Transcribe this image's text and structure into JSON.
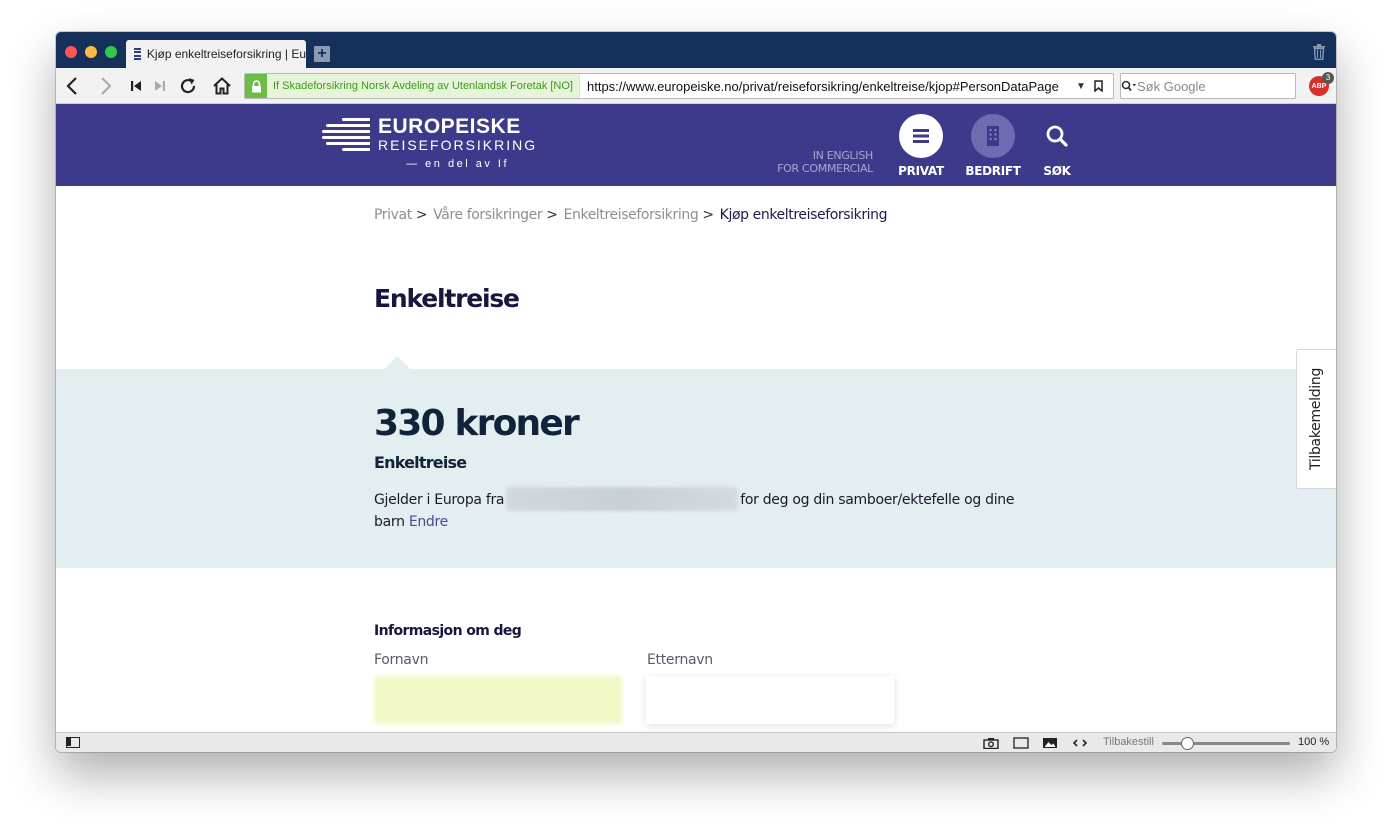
{
  "browser": {
    "tab_title": "Kjøp enkeltreiseforsikring | Eu",
    "new_tab_label": "+",
    "certificate": "If Skadeforsikring Norsk Avdeling av Utenlandsk Foretak [NO]",
    "url": "https://www.europeiske.no/privat/reiseforsikring/enkeltreise/kjop#PersonDataPage",
    "search_placeholder": "Søk Google",
    "adblock_label": "ABP",
    "adblock_count": "3"
  },
  "site": {
    "logo_name": "EUROPEISKE",
    "logo_sub": "REISEFORSIKRING",
    "logo_tagline": "— en del av If",
    "alt_links": [
      "IN ENGLISH",
      "FOR COMMERCIAL"
    ],
    "nav": [
      {
        "label": "PRIVAT"
      },
      {
        "label": "BEDRIFT"
      },
      {
        "label": "SØK"
      }
    ]
  },
  "breadcrumb": [
    {
      "label": "Privat"
    },
    {
      "label": "Våre forsikringer"
    },
    {
      "label": "Enkeltreiseforsikring"
    },
    {
      "label": "Kjøp enkeltreiseforsikring"
    }
  ],
  "breadcrumb_separator": ">",
  "page_title": "Enkeltreise",
  "price": {
    "amount": "330 kroner",
    "product": "Enkeltreise",
    "coverage_prefix": "Gjelder i Europa fra",
    "coverage_suffix": "for deg og din samboer/ektefelle og dine barn",
    "change_link": "Endre"
  },
  "form": {
    "heading": "Informasjon om deg",
    "first_name_label": "Fornavn",
    "last_name_label": "Etternavn"
  },
  "feedback_tab": "Tilbakemelding",
  "statusbar": {
    "reset_label": "Tilbakestill",
    "zoom_label": "100 %",
    "zoom_percent": 100
  },
  "colors": {
    "header_bg": "#3d3a8c",
    "price_bg": "#e3eef0",
    "tabbar_bg": "#15305a",
    "link": "#4c4899"
  }
}
